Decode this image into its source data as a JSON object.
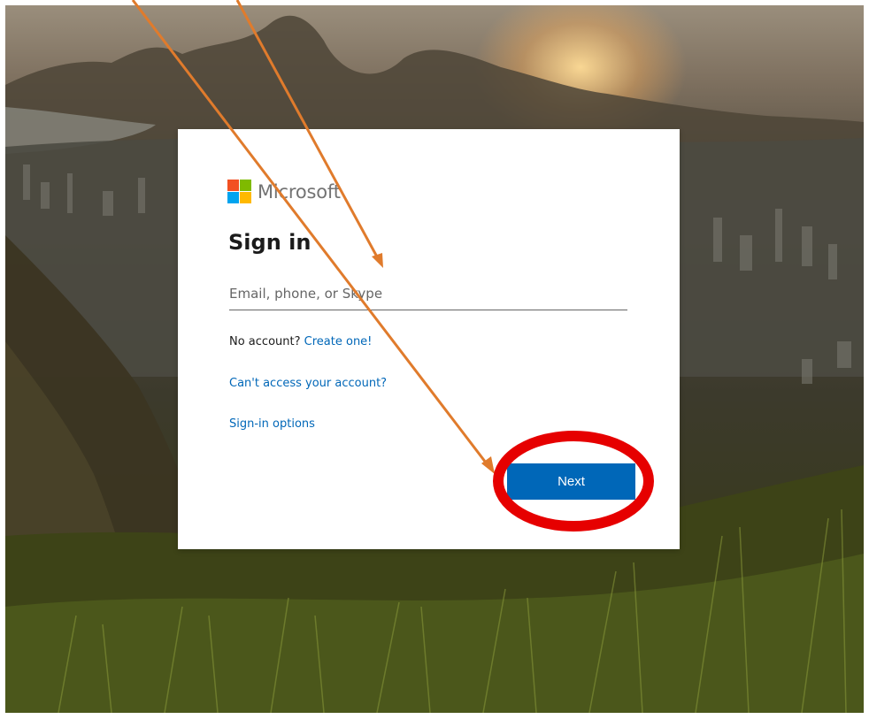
{
  "brand": {
    "name": "Microsoft",
    "logo_colors": [
      "#f25022",
      "#7fba00",
      "#00a4ef",
      "#ffb900"
    ]
  },
  "signin": {
    "title": "Sign in",
    "input_placeholder": "Email, phone, or Skype",
    "input_value": "",
    "no_account_text": "No account?",
    "create_link": "Create one!",
    "cant_access_link": "Can't access your account?",
    "options_link": "Sign-in options",
    "next_label": "Next"
  },
  "annotations": {
    "arrow_color": "#e07b2c",
    "circle_color": "#e60000",
    "arrow_icons": [
      "arrow-icon",
      "arrow-icon"
    ],
    "highlight_icon": "highlight-circle-icon"
  },
  "theme": {
    "accent": "#0067b8",
    "link": "#0067b8",
    "text": "#1b1b1b"
  }
}
